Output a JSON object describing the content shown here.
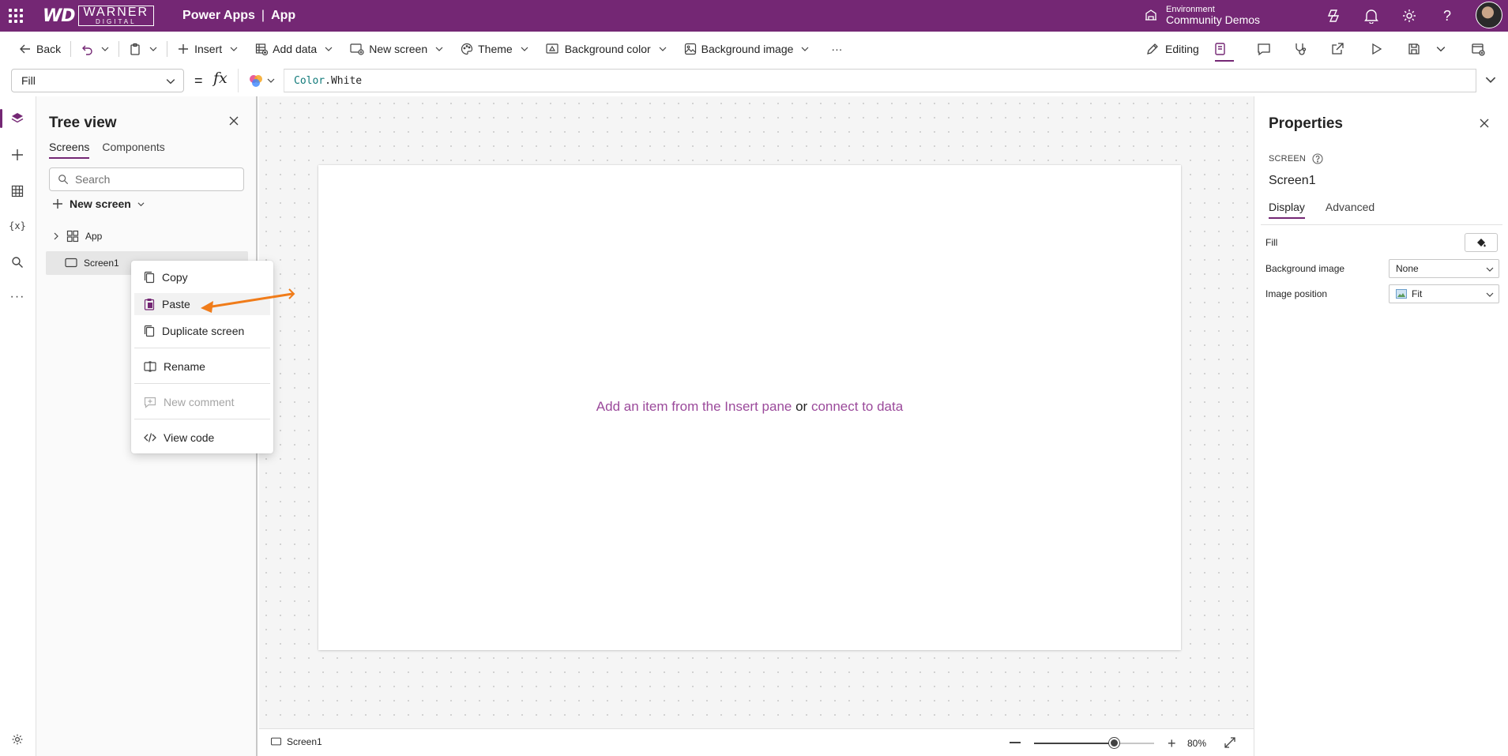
{
  "topbar": {
    "logo_wd": "WD",
    "logo_brand": "WARNER",
    "logo_sub": "DIGITAL",
    "product": "Power Apps",
    "separator": "|",
    "app_name": "App",
    "environment_label": "Environment",
    "environment_name": "Community Demos",
    "icons": [
      "waffle-icon",
      "environment-icon",
      "copilot-icon",
      "bell-icon",
      "gear-icon",
      "help-icon",
      "avatar"
    ]
  },
  "commandbar": {
    "back": "Back",
    "insert": "Insert",
    "add_data": "Add data",
    "new_screen": "New screen",
    "theme": "Theme",
    "background_color": "Background color",
    "background_image": "Background image",
    "more": "···",
    "editing": "Editing"
  },
  "formulabar": {
    "property": "Fill",
    "equals": "=",
    "fx": "fx",
    "formula_ns": "Color",
    "formula_member": ".White"
  },
  "treeview": {
    "title": "Tree view",
    "tabs": [
      "Screens",
      "Components"
    ],
    "search_placeholder": "Search",
    "new_screen": "New screen",
    "nodes": [
      "App",
      "Screen1"
    ]
  },
  "context_menu": {
    "items": [
      {
        "label": "Copy",
        "icon": "copy-icon"
      },
      {
        "label": "Paste",
        "icon": "paste-icon"
      },
      {
        "label": "Duplicate screen",
        "icon": "duplicate-icon"
      },
      {
        "label": "Rename",
        "icon": "rename-icon"
      },
      {
        "label": "New comment",
        "icon": "comment-icon",
        "disabled": true
      },
      {
        "label": "View code",
        "icon": "code-icon"
      }
    ]
  },
  "canvas": {
    "hint_part1": "Add an item from the Insert pane",
    "hint_or": " or ",
    "hint_part2": "connect to data"
  },
  "statusbar": {
    "screen": "Screen1",
    "zoom": "80%",
    "zoom_fraction": 0.67
  },
  "properties": {
    "title": "Properties",
    "kind": "SCREEN",
    "name": "Screen1",
    "tabs": [
      "Display",
      "Advanced"
    ],
    "fill_label": "Fill",
    "bg_image_label": "Background image",
    "bg_image_value": "None",
    "image_position_label": "Image position",
    "image_position_value": "Fit"
  },
  "colors": {
    "brand": "#742774",
    "link": "#9b4a9b",
    "annotation_arrow": "#f07c1a"
  }
}
